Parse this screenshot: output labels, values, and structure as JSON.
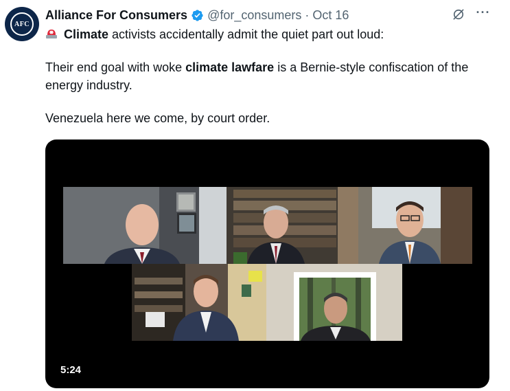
{
  "account": {
    "display_name": "Alliance For Consumers",
    "handle": "@for_consumers",
    "separator": "·",
    "date": "Oct 16",
    "avatar_text": "AFC",
    "brand_color": "#0d2649",
    "verified_color": "#1d9bf0"
  },
  "tweet": {
    "line1_bold": "Climate",
    "line1_rest": " activists accidentally admit the quiet part out loud:",
    "para2_start": "Their end goal with woke ",
    "para2_bold": "climate lawfare",
    "para2_end": " is a Bernie-style confiscation of the energy industry.",
    "para3": "Venezuela here we come, by court order."
  },
  "icons": {
    "emoji": "police-siren-icon",
    "verified": "verified-badge-icon",
    "grok": "grok-icon",
    "more": "more-options-icon"
  },
  "actions": {
    "more_label": "···"
  },
  "video": {
    "duration": "5:24"
  }
}
